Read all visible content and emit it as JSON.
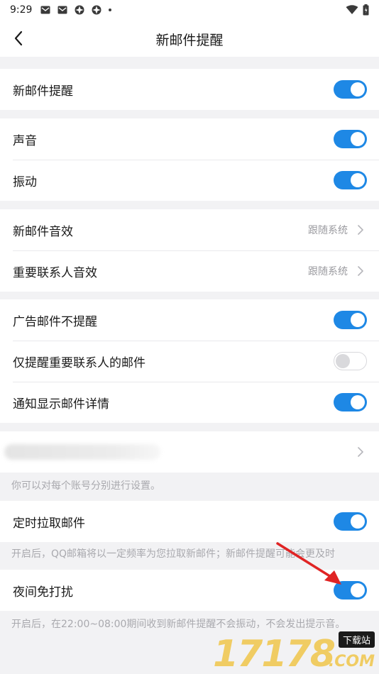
{
  "status_bar": {
    "time": "9:29"
  },
  "nav": {
    "title": "新邮件提醒"
  },
  "groups": {
    "g1": {
      "new_mail": "新邮件提醒"
    },
    "g2": {
      "sound": "声音",
      "vibrate": "振动"
    },
    "g3": {
      "new_mail_sound": "新邮件音效",
      "new_mail_sound_value": "跟随系统",
      "vip_sound": "重要联系人音效",
      "vip_sound_value": "跟随系统"
    },
    "g4": {
      "no_ad_alert": "广告邮件不提醒",
      "only_vip": "仅提醒重要联系人的邮件",
      "show_details": "通知显示邮件详情"
    },
    "g6": {
      "scheduled_fetch": "定时拉取邮件"
    },
    "g7": {
      "night_dnd": "夜间免打扰"
    }
  },
  "hints": {
    "account_hint": "你可以对每个账号分别进行设置。",
    "fetch_hint": "开启后，QQ邮箱将以一定频率为您拉取新邮件；新邮件提醒可能会更及时",
    "dnd_hint": "开启后，在22:00~08:00期间收到新邮件提醒不会振动，不会发出提示音。"
  },
  "toggles": {
    "new_mail": true,
    "sound": true,
    "vibrate": true,
    "no_ad_alert": true,
    "only_vip": false,
    "show_details": true,
    "scheduled_fetch": true,
    "night_dnd": true
  },
  "watermark": {
    "text": "17178",
    "badge": "下载站",
    "domain": ".COM"
  },
  "colors": {
    "accent": "#1e88e5",
    "annotation_arrow": "#e02424"
  },
  "icons": [
    "mail-icon",
    "mail-icon",
    "app-icon",
    "app-icon",
    "wifi-icon",
    "battery-icon",
    "back-arrow-icon",
    "chevron-right-icon"
  ]
}
